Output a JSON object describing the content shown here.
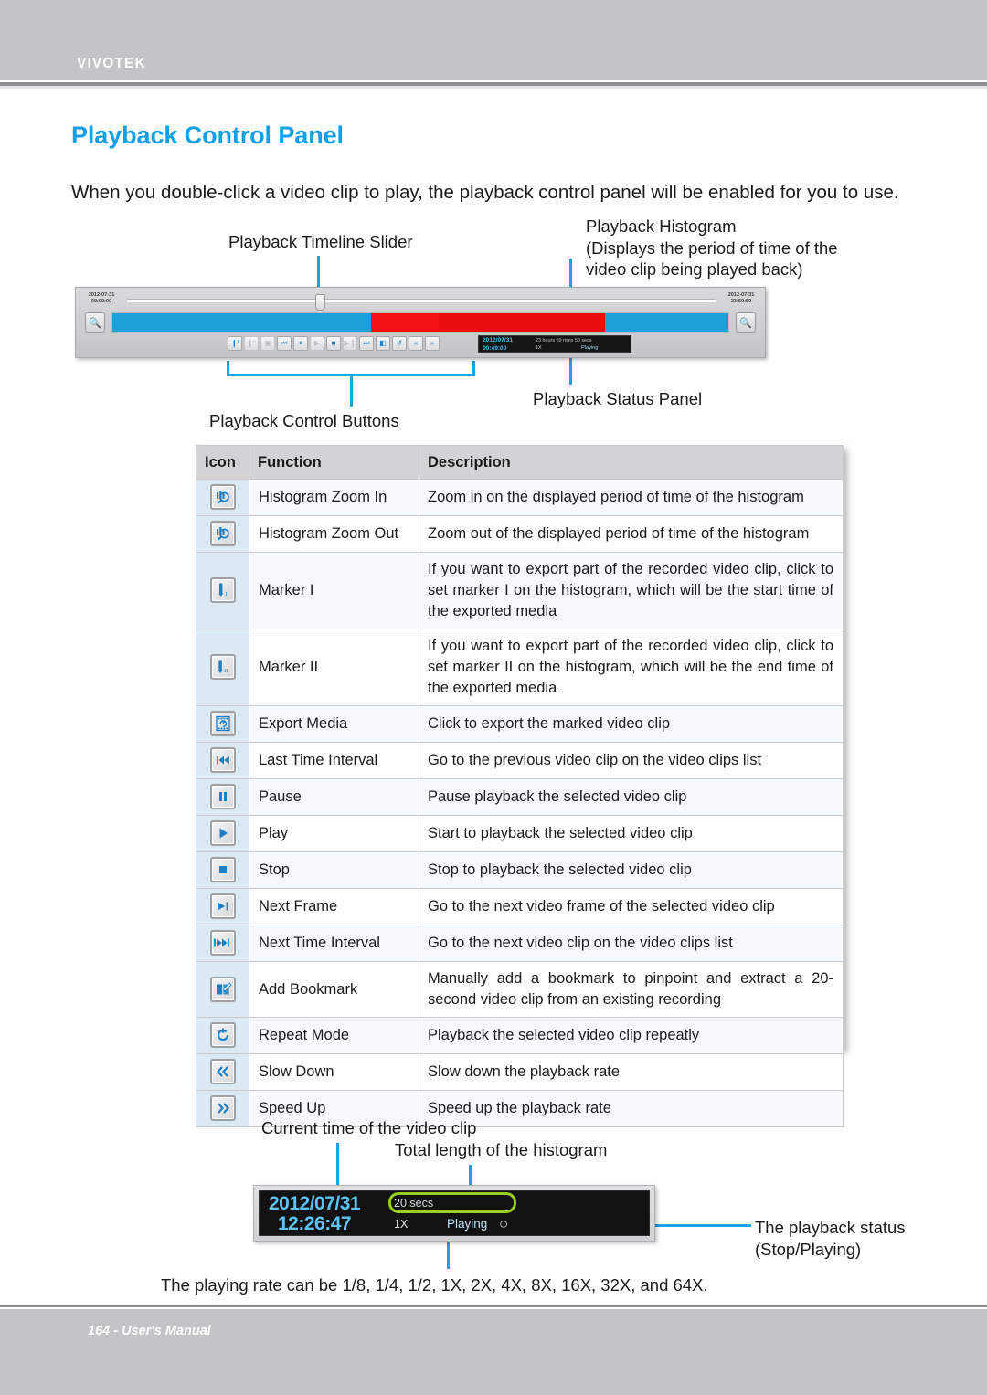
{
  "header": {
    "brand": "VIVOTEK"
  },
  "page": {
    "title": "Playback Control Panel",
    "intro": "When you double-click a video clip to play, the playback control panel will be enabled for you to use."
  },
  "callouts": {
    "timeline_slider": "Playback Timeline Slider",
    "histogram": "Playback Histogram\n(Displays the period of time of the\nvideo clip being played back)",
    "status_panel": "Playback Status Panel",
    "control_buttons": "Playback Control Buttons",
    "current_time": "Current time of the video clip",
    "total_length": "Total length of the histogram",
    "playback_status": "The playback status\n(Stop/Playing)"
  },
  "panel_figure": {
    "start_time": "2012-07-31\n00:00:00",
    "end_time": "2012-07-31\n23:59:59",
    "zoom_in_icon": "histogram-zoom-in-icon",
    "zoom_out_icon": "histogram-zoom-out-icon",
    "histogram_segments": [
      {
        "color": "#1e9fd8",
        "width_pct": 42
      },
      {
        "color": "#f21212",
        "width_pct": 11
      },
      {
        "color": "#ec0d0d",
        "width_pct": 27
      },
      {
        "color": "#1e9fd8",
        "width_pct": 20
      }
    ],
    "control_buttons": [
      {
        "name": "marker-1-button",
        "glyph": "❙ᴵ",
        "dim": false
      },
      {
        "name": "marker-2-button",
        "glyph": "❙ᴵᴵ",
        "dim": true
      },
      {
        "name": "export-media-button",
        "glyph": "▣",
        "dim": true
      },
      {
        "name": "last-time-interval-button",
        "glyph": "⏮",
        "dim": false
      },
      {
        "name": "pause-button",
        "glyph": "⏸",
        "dim": false
      },
      {
        "name": "play-button",
        "glyph": "▶",
        "dim": true
      },
      {
        "name": "stop-button",
        "glyph": "■",
        "dim": false
      },
      {
        "name": "next-frame-button",
        "glyph": "▶❙",
        "dim": true
      },
      {
        "name": "next-time-interval-button",
        "glyph": "⏭",
        "dim": false
      },
      {
        "name": "add-bookmark-button",
        "glyph": "◧",
        "dim": false
      },
      {
        "name": "repeat-mode-button",
        "glyph": "↺",
        "dim": false
      },
      {
        "name": "slow-down-button",
        "glyph": "«",
        "dim": false
      },
      {
        "name": "speed-up-button",
        "glyph": "»",
        "dim": false
      }
    ],
    "status_mini": {
      "date": "2012/07/31",
      "time": "00:49:00",
      "total": "23 hours 59 mins 59 secs",
      "rate": "1X",
      "state": "Playing"
    }
  },
  "table": {
    "headers": {
      "icon": "Icon",
      "function": "Function",
      "description": "Description"
    },
    "rows": [
      {
        "icon": "histogram-zoom-in-icon",
        "function": "Histogram Zoom In",
        "description": "Zoom in on the displayed period of time of the histogram"
      },
      {
        "icon": "histogram-zoom-out-icon",
        "function": "Histogram Zoom Out",
        "description": "Zoom out of the displayed period of time of the histogram"
      },
      {
        "icon": "marker-1-icon",
        "function": "Marker I",
        "description": "If you want to export part of the recorded video clip, click to set marker I on the histogram, which will be the start time of the exported media"
      },
      {
        "icon": "marker-2-icon",
        "function": "Marker II",
        "description": "If you want to export part of the recorded video clip, click to set marker II on the histogram, which will be the end time of the exported media"
      },
      {
        "icon": "export-media-icon",
        "function": "Export Media",
        "description": "Click to export the marked video clip"
      },
      {
        "icon": "last-time-interval-icon",
        "function": "Last Time Interval",
        "description": "Go to the previous video clip on the video clips list"
      },
      {
        "icon": "pause-icon",
        "function": "Pause",
        "description": "Pause playback the selected video clip"
      },
      {
        "icon": "play-icon",
        "function": "Play",
        "description": "Start to playback the selected video clip"
      },
      {
        "icon": "stop-icon",
        "function": "Stop",
        "description": "Stop to playback the selected video clip"
      },
      {
        "icon": "next-frame-icon",
        "function": "Next Frame",
        "description": "Go to the next video frame of the selected video clip"
      },
      {
        "icon": "next-time-interval-icon",
        "function": "Next Time Interval",
        "description": "Go to the next video clip on the video clips list"
      },
      {
        "icon": "add-bookmark-icon",
        "function": "Add Bookmark",
        "description": "Manually add a bookmark to pinpoint and extract a 20-second video clip from an existing recording"
      },
      {
        "icon": "repeat-mode-icon",
        "function": "Repeat Mode",
        "description": "Playback the selected video clip repeatly"
      },
      {
        "icon": "slow-down-icon",
        "function": "Slow Down",
        "description": "Slow down the playback rate"
      },
      {
        "icon": "speed-up-icon",
        "function": "Speed Up",
        "description": "Speed up the playback rate"
      }
    ]
  },
  "status_figure": {
    "date": "2012/07/31",
    "time": "12:26:47",
    "total_length": "20 secs",
    "rate": "1X",
    "state": "Playing",
    "spinner": "○",
    "highlight_color": "#9ace27"
  },
  "note": {
    "playing_rate": "The playing rate can be 1/8, 1/4, 1/2, 1X, 2X, 4X, 8X, 16X, 32X, and 64X."
  },
  "footer": {
    "text": "164 - User's Manual"
  }
}
